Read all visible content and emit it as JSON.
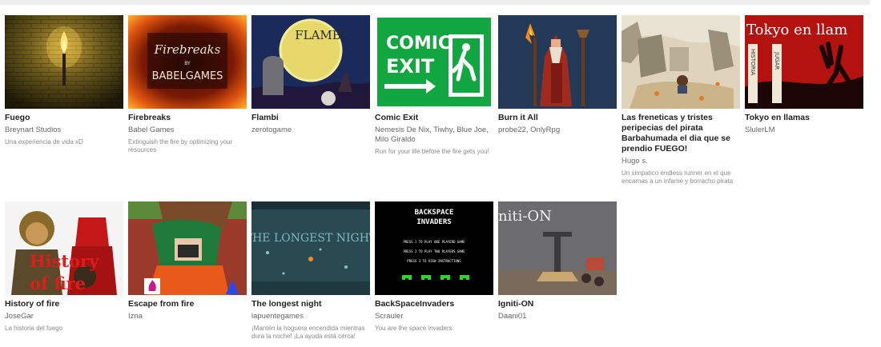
{
  "games_row1": [
    {
      "title": "Fuego",
      "author": "Breynart Studios",
      "desc": "Una experiencia de vida xD"
    },
    {
      "title": "Firebreaks",
      "author": "Babel Games",
      "desc": "Extinguish the fire by optimizing your resources",
      "thumb_text": [
        "Firebreaks",
        "BY",
        "BABELGAMES"
      ]
    },
    {
      "title": "Flambi",
      "author": "zerotogame",
      "desc": "",
      "thumb_text": [
        "FLAMBI"
      ]
    },
    {
      "title": "Comic Exit",
      "author": "Nemesis De Nix, Tiwhy, Blue Joe, Milo Giraldo",
      "desc": "Run for your life before the fire gets you!",
      "thumb_text": [
        "COMIC",
        "EXIT"
      ]
    },
    {
      "title": "Burn it All",
      "author": "probe22, OnlyRpg",
      "desc": ""
    },
    {
      "title": "Las freneticas y tristes peripecias del pirata Barbahumada el dia que se prendio FUEGO!",
      "author": "Hugo s.",
      "desc": "Un simpatico endless runner en el que encarnas a un infame y borracho pirata"
    },
    {
      "title": "Tokyo en llamas",
      "author": "SlulerLM",
      "desc": "",
      "thumb_text": [
        "Tokyo en llam",
        "HISTORIA",
        "JUGAR"
      ]
    }
  ],
  "games_row2": [
    {
      "title": "History of fire",
      "author": "JoseGar",
      "desc": "La historia del fuego",
      "thumb_text": [
        "History",
        "of fire"
      ]
    },
    {
      "title": "Escape from fire",
      "author": "Izna",
      "desc": ""
    },
    {
      "title": "The longest night",
      "author": "lapuentegames",
      "desc": "¡Mantén la hoguera encendida mientras dura la noche! ¡La ayuda está cerca!",
      "thumb_text": [
        "THE LONGEST NIGHT"
      ]
    },
    {
      "title": "BackSpaceInvaders",
      "author": "Scrauler",
      "desc": "You are the space invaders",
      "thumb_text": [
        "BACKSPACE",
        "INVADERS",
        "PRESS 1 TO PLAY ONE PLAYERD GAME",
        "PRESS 2 TO PLAY TWO PLAYERS GAME",
        "PRESS 3 TO VIEW INSTRUCTIONS"
      ]
    },
    {
      "title": "Igniti-ON",
      "author": "Daani01",
      "desc": "",
      "thumb_text": [
        "niti-ON"
      ]
    }
  ]
}
